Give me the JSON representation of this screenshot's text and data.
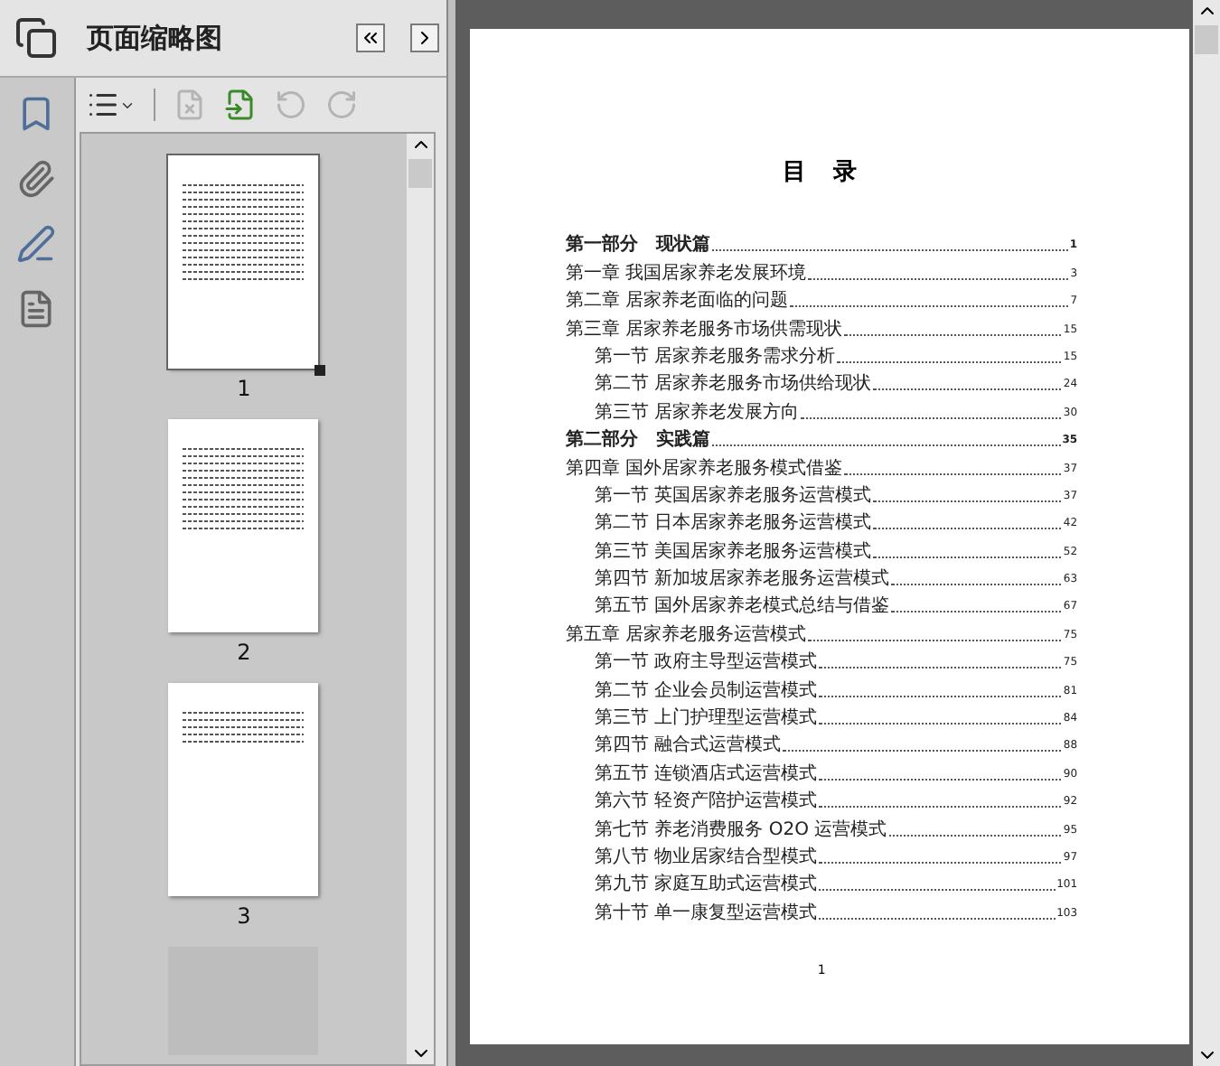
{
  "panel": {
    "title": "页面缩略图"
  },
  "toolbar": [
    {
      "kind": "options",
      "disabled": false
    },
    {
      "kind": "delete",
      "disabled": true
    },
    {
      "kind": "insert",
      "disabled": false
    },
    {
      "kind": "rotate-left",
      "disabled": true
    },
    {
      "kind": "rotate-right",
      "disabled": true
    }
  ],
  "thumbnails": [
    {
      "label": "1",
      "selected": true
    },
    {
      "label": "2",
      "selected": false
    },
    {
      "label": "3",
      "selected": false
    }
  ],
  "document": {
    "heading": "目  录",
    "page_number": "1",
    "toc": [
      {
        "kind": "part",
        "title": "第一部分　现状篇",
        "page": "1"
      },
      {
        "kind": "chapter",
        "title": "第一章 我国居家养老发展环境",
        "page": "3"
      },
      {
        "kind": "chapter",
        "title": "第二章 居家养老面临的问题",
        "page": "7"
      },
      {
        "kind": "chapter",
        "title": "第三章 居家养老服务市场供需现状",
        "page": "15"
      },
      {
        "kind": "section",
        "title": "第一节 居家养老服务需求分析",
        "page": "15"
      },
      {
        "kind": "section",
        "title": "第二节 居家养老服务市场供给现状",
        "page": "24"
      },
      {
        "kind": "section",
        "title": "第三节 居家养老发展方向",
        "page": "30"
      },
      {
        "kind": "part",
        "title": "第二部分　实践篇",
        "page": "35"
      },
      {
        "kind": "chapter",
        "title": "第四章 国外居家养老服务模式借鉴",
        "page": "37"
      },
      {
        "kind": "section",
        "title": "第一节 英国居家养老服务运营模式",
        "page": "37"
      },
      {
        "kind": "section",
        "title": "第二节 日本居家养老服务运营模式",
        "page": "42"
      },
      {
        "kind": "section",
        "title": "第三节 美国居家养老服务运营模式",
        "page": "52"
      },
      {
        "kind": "section",
        "title": "第四节 新加坡居家养老服务运营模式",
        "page": "63"
      },
      {
        "kind": "section",
        "title": "第五节 国外居家养老模式总结与借鉴",
        "page": "67"
      },
      {
        "kind": "chapter",
        "title": "第五章 居家养老服务运营模式",
        "page": "75"
      },
      {
        "kind": "section",
        "title": "第一节 政府主导型运营模式",
        "page": "75"
      },
      {
        "kind": "section",
        "title": "第二节 企业会员制运营模式",
        "page": "81"
      },
      {
        "kind": "section",
        "title": "第三节 上门护理型运营模式",
        "page": "84"
      },
      {
        "kind": "section",
        "title": "第四节 融合式运营模式",
        "page": "88"
      },
      {
        "kind": "section",
        "title": "第五节 连锁酒店式运营模式",
        "page": "90"
      },
      {
        "kind": "section",
        "title": "第六节 轻资产陪护运营模式",
        "page": "92"
      },
      {
        "kind": "section",
        "title": "第七节 养老消费服务 O2O 运营模式",
        "page": "95"
      },
      {
        "kind": "section",
        "title": "第八节 物业居家结合型模式",
        "page": "97"
      },
      {
        "kind": "section",
        "title": "第九节 家庭互助式运营模式",
        "page": "101"
      },
      {
        "kind": "section",
        "title": "第十节 单一康复型运营模式",
        "page": "103"
      }
    ]
  }
}
